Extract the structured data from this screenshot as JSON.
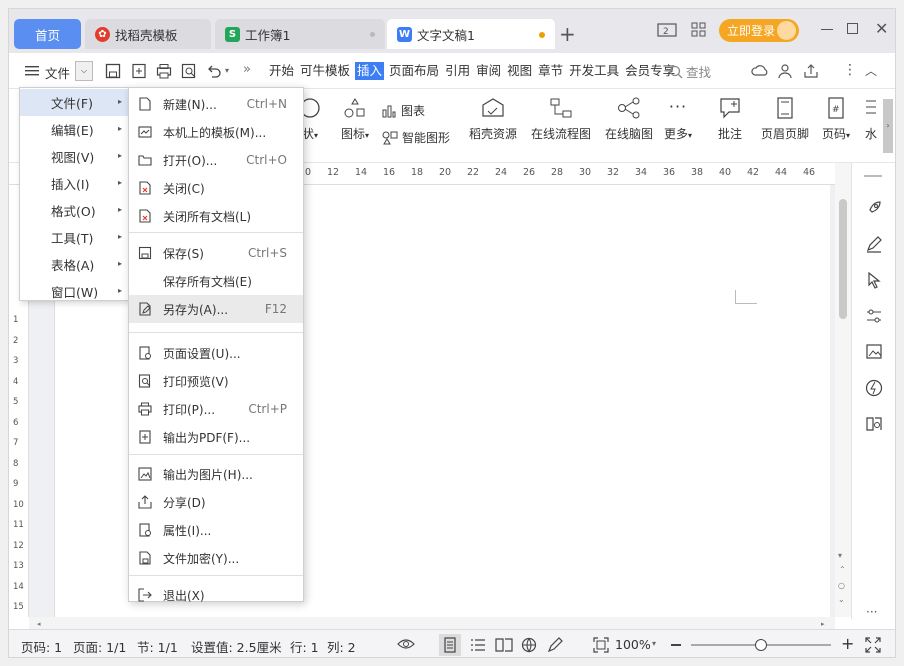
{
  "tabs": {
    "home": "首页",
    "t2": "找稻壳模板",
    "t3": "工作簿1",
    "t4": "文字文稿1",
    "add": "+"
  },
  "titlebar": {
    "login": "立即登录"
  },
  "toolbar": {
    "file_label": "文件",
    "menu_tabs": [
      "开始",
      "可牛模板",
      "插入",
      "页面布局",
      "引用",
      "审阅",
      "视图",
      "章节",
      "开发工具",
      "会员专享"
    ],
    "active_tab": "插入",
    "search": "查找"
  },
  "ribbon": {
    "shape": "状",
    "icons": "图标",
    "chart": "图表",
    "smart": "智能图形",
    "daoke": "稻壳资源",
    "flow": "在线流程图",
    "mind": "在线脑图",
    "more": "更多",
    "comment": "批注",
    "header": "页眉页脚",
    "pagenum": "页码",
    "water": "水"
  },
  "ruler": {
    "ticks": [
      "10",
      "12",
      "14",
      "16",
      "18",
      "20",
      "22",
      "24",
      "26",
      "28",
      "30",
      "32",
      "34",
      "36",
      "38",
      "40",
      "42",
      "44",
      "46"
    ],
    "vticks": [
      "1",
      "2",
      "3",
      "4",
      "5",
      "6",
      "7",
      "8",
      "9",
      "10",
      "11",
      "12",
      "13",
      "14",
      "15"
    ]
  },
  "menu_level1": [
    {
      "label": "文件(F)"
    },
    {
      "label": "编辑(E)"
    },
    {
      "label": "视图(V)"
    },
    {
      "label": "插入(I)"
    },
    {
      "label": "格式(O)"
    },
    {
      "label": "工具(T)"
    },
    {
      "label": "表格(A)"
    },
    {
      "label": "窗口(W)"
    }
  ],
  "menu_file": [
    {
      "label": "新建(N)...",
      "shortcut": "Ctrl+N",
      "icon": "new-doc-icon"
    },
    {
      "label": "本机上的模板(M)...",
      "shortcut": "",
      "icon": "template-icon"
    },
    {
      "label": "打开(O)...",
      "shortcut": "Ctrl+O",
      "icon": "folder-open-icon"
    },
    {
      "label": "关闭(C)",
      "shortcut": "",
      "icon": "close-doc-icon"
    },
    {
      "label": "关闭所有文档(L)",
      "shortcut": "",
      "icon": "close-all-icon"
    },
    {
      "label": "保存(S)",
      "shortcut": "Ctrl+S",
      "icon": "save-icon"
    },
    {
      "label": "保存所有文档(E)",
      "shortcut": "",
      "icon": ""
    },
    {
      "label": "另存为(A)...",
      "shortcut": "F12",
      "icon": "save-as-icon"
    },
    {
      "label": "页面设置(U)...",
      "shortcut": "",
      "icon": "page-setup-icon"
    },
    {
      "label": "打印预览(V)",
      "shortcut": "",
      "icon": "print-preview-icon"
    },
    {
      "label": "打印(P)...",
      "shortcut": "Ctrl+P",
      "icon": "print-icon"
    },
    {
      "label": "输出为PDF(F)...",
      "shortcut": "",
      "icon": "pdf-export-icon"
    },
    {
      "label": "输出为图片(H)...",
      "shortcut": "",
      "icon": "image-export-icon"
    },
    {
      "label": "分享(D)",
      "shortcut": "",
      "icon": "share-icon"
    },
    {
      "label": "属性(I)...",
      "shortcut": "",
      "icon": "properties-icon"
    },
    {
      "label": "文件加密(Y)...",
      "shortcut": "",
      "icon": "encrypt-icon"
    },
    {
      "label": "退出(X)",
      "shortcut": "",
      "icon": "exit-icon"
    }
  ],
  "status": {
    "page_code": "页码: 1",
    "pages": "页面: 1/1",
    "section": "节: 1/1",
    "setting": "设置值: 2.5厘米",
    "row": "行: 1",
    "col": "列: 2",
    "zoom": "100%",
    "zoom_level": 0.5
  },
  "colors": {
    "accent": "#3d7ef5",
    "home_tab": "#5a8ef0",
    "login": "#f5a623"
  }
}
